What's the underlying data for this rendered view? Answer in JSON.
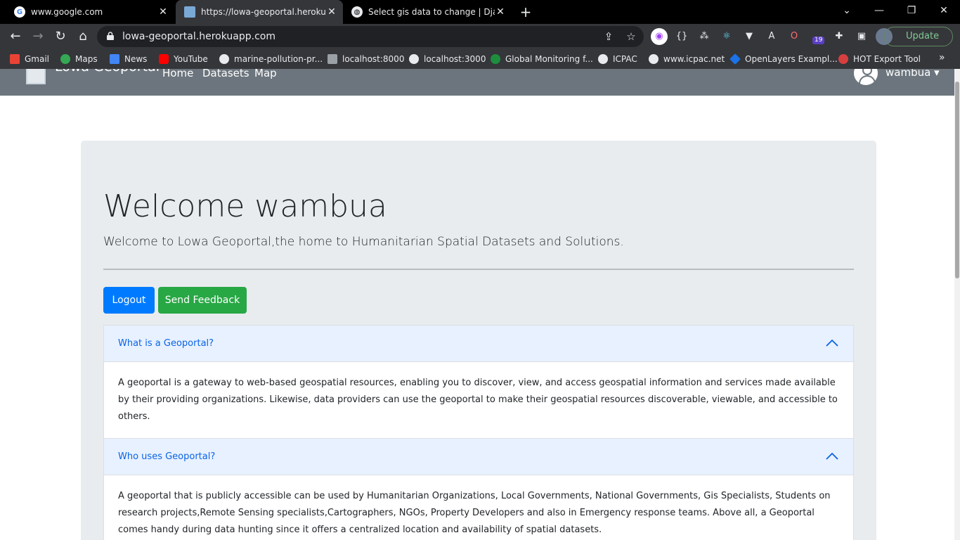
{
  "browser": {
    "tabs": [
      {
        "title": "www.google.com",
        "active": false,
        "icon": "google-icon"
      },
      {
        "title": "https://lowa-geoportal.herokuapp",
        "active": true,
        "icon": "map-icon"
      },
      {
        "title": "Select gis data to change | Djang",
        "active": false,
        "icon": "globe-icon"
      }
    ],
    "new_tab": "+",
    "window_controls": {
      "dropdown": "⌄",
      "minimize": "—",
      "restore": "❐",
      "close": "✕"
    },
    "url": "lowa-geoportal.herokuapp.com",
    "update_label": "Update",
    "extension_badge": "19",
    "bookmarks": [
      {
        "label": "Gmail",
        "icon": "gmail-icon",
        "color": "#ea4335"
      },
      {
        "label": "Maps",
        "icon": "maps-icon",
        "color": "#34a853"
      },
      {
        "label": "News",
        "icon": "news-icon",
        "color": "#4285f4"
      },
      {
        "label": "YouTube",
        "icon": "youtube-icon",
        "color": "#ff0000"
      },
      {
        "label": "marine-pollution-pr...",
        "icon": "globe-icon",
        "color": "#e8eaed"
      },
      {
        "label": "localhost:8000",
        "icon": "map-icon",
        "color": "#9aa0a6"
      },
      {
        "label": "localhost:3000",
        "icon": "globe-icon",
        "color": "#e8eaed"
      },
      {
        "label": "Global Monitoring f...",
        "icon": "gmes-icon",
        "color": "#1e8e3e"
      },
      {
        "label": "ICPAC",
        "icon": "globe-icon",
        "color": "#e8eaed"
      },
      {
        "label": "www.icpac.net",
        "icon": "globe-icon",
        "color": "#e8eaed"
      },
      {
        "label": "OpenLayers Exampl...",
        "icon": "openlayers-icon",
        "color": "#1a73e8"
      },
      {
        "label": "HOT Export Tool",
        "icon": "hot-icon",
        "color": "#d73f3f"
      }
    ],
    "bookmarks_overflow": "»"
  },
  "site": {
    "brand": "Lowa Geoportal",
    "nav": [
      "Home",
      "Datasets",
      "Map"
    ],
    "username": "wambua",
    "nav_bg": "#6c757d"
  },
  "jumbotron": {
    "heading": "Welcome wambua",
    "lead": "Welcome to Lowa Geoportal,the home to Humanitarian Spatial Datasets and Solutions.",
    "logout_label": "Logout",
    "feedback_label": "Send Feedback"
  },
  "accordion": [
    {
      "question": "What is a Geoportal?",
      "answer": "A geoportal is a gateway to web-based geospatial resources, enabling you to discover, view, and access geospatial information and services made available by their providing organizations. Likewise, data providers can use the geoportal to make their geospatial resources discoverable, viewable, and accessible to others."
    },
    {
      "question": "Who uses Geoportal?",
      "answer": "A geoportal that is publicly accessible can be used by Humanitarian Organizations, Local Governments, National Governments, Gis Specialists, Students on research projects,Remote Sensing specialists,Cartographers, NGOs, Property Developers and also in Emergency response teams. Above all, a Geoportal comes handy during data hunting since it offers a centralized location and availability of spatial datasets."
    }
  ],
  "colors": {
    "primary": "#007bff",
    "success": "#28a745",
    "accordion_header_bg": "#e7f1ff",
    "accordion_title": "#0c63e4"
  }
}
